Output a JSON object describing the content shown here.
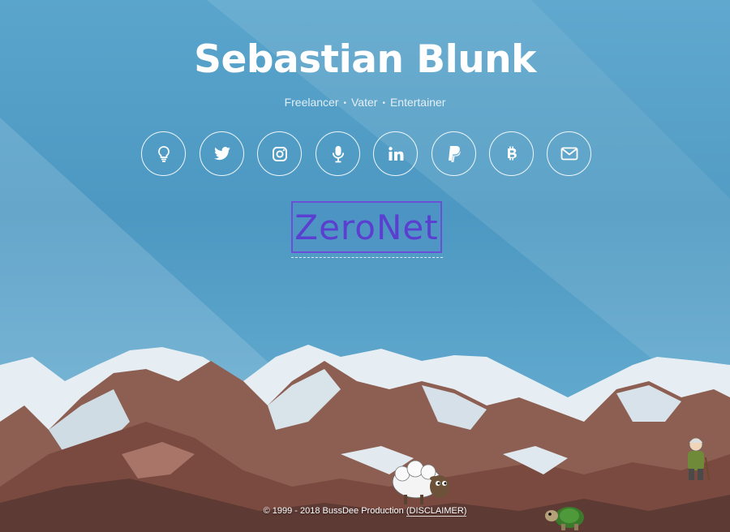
{
  "header": {
    "title": "Sebastian Blunk",
    "subtitle_parts": [
      "Freelancer",
      "Vater",
      "Entertainer"
    ],
    "separator": "•"
  },
  "social_icons": [
    {
      "name": "lightbulb-icon"
    },
    {
      "name": "twitter-icon"
    },
    {
      "name": "instagram-icon"
    },
    {
      "name": "microphone-icon"
    },
    {
      "name": "linkedin-icon"
    },
    {
      "name": "paypal-icon"
    },
    {
      "name": "bitcoin-icon"
    },
    {
      "name": "envelope-icon"
    }
  ],
  "zeronet": {
    "label": "ZeroNet"
  },
  "footer": {
    "copyright": "© 1999 - 2018 BussDee Production",
    "disclaimer": "(DISCLAIMER)"
  },
  "colors": {
    "accent": "#5a3fd0",
    "background": "#4d9ac4"
  }
}
